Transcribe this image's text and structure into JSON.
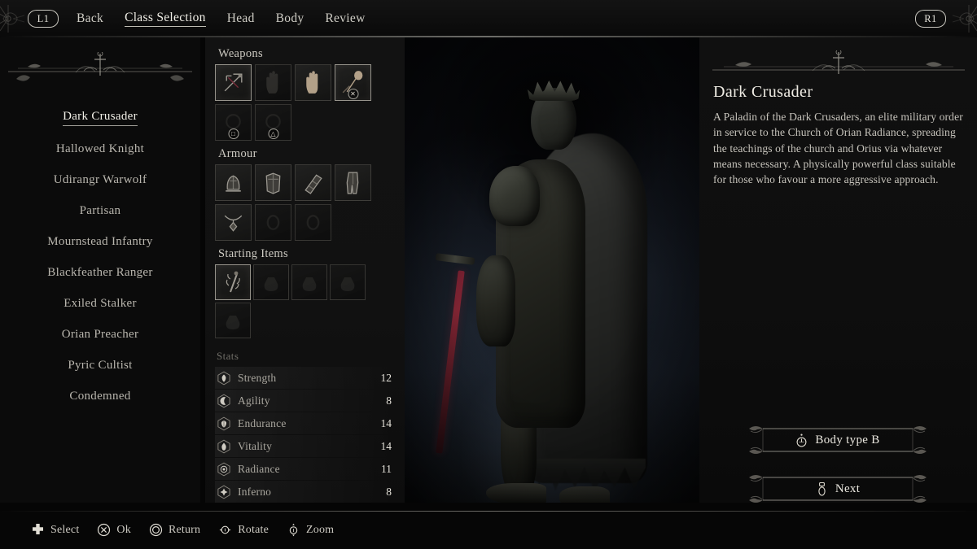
{
  "header": {
    "left_button": "L1",
    "right_button": "R1",
    "nav": [
      {
        "label": "Back",
        "active": false
      },
      {
        "label": "Class Selection",
        "active": true
      },
      {
        "label": "Head",
        "active": false
      },
      {
        "label": "Body",
        "active": false
      },
      {
        "label": "Review",
        "active": false
      }
    ]
  },
  "classes": [
    {
      "label": "Dark Crusader",
      "selected": true
    },
    {
      "label": "Hallowed Knight",
      "selected": false
    },
    {
      "label": "Udirangr Warwolf",
      "selected": false
    },
    {
      "label": "Partisan",
      "selected": false
    },
    {
      "label": "Mournstead Infantry",
      "selected": false
    },
    {
      "label": "Blackfeather Ranger",
      "selected": false
    },
    {
      "label": "Exiled Stalker",
      "selected": false
    },
    {
      "label": "Orian Preacher",
      "selected": false
    },
    {
      "label": "Pyric Cultist",
      "selected": false
    },
    {
      "label": "Condemned",
      "selected": false
    }
  ],
  "equipment": {
    "weapons_title": "Weapons",
    "weapons": [
      {
        "icon": "crossbow-icon",
        "empty": false,
        "selected": true,
        "pad": ""
      },
      {
        "icon": "left-hand-icon",
        "empty": true,
        "selected": false,
        "pad": ""
      },
      {
        "icon": "right-hand-icon",
        "empty": false,
        "selected": false,
        "pad": ""
      },
      {
        "icon": "mace-icon",
        "empty": false,
        "selected": true,
        "pad": "✕"
      },
      {
        "icon": "empty-slot-icon",
        "empty": true,
        "selected": false,
        "pad": "□"
      },
      {
        "icon": "empty-slot-icon",
        "empty": true,
        "selected": false,
        "pad": "△"
      }
    ],
    "armour_title": "Armour",
    "armour": [
      {
        "icon": "helmet-icon",
        "empty": false,
        "selected": false
      },
      {
        "icon": "chest-armour-icon",
        "empty": false,
        "selected": false
      },
      {
        "icon": "gauntlet-icon",
        "empty": false,
        "selected": false
      },
      {
        "icon": "leg-armour-icon",
        "empty": false,
        "selected": false
      },
      {
        "icon": "amulet-icon",
        "empty": false,
        "selected": false
      },
      {
        "icon": "ring-slot-icon",
        "empty": true,
        "selected": false
      },
      {
        "icon": "ring-slot-icon",
        "empty": true,
        "selected": false
      }
    ],
    "items_title": "Starting Items",
    "items": [
      {
        "icon": "sanguinarix-icon",
        "empty": false,
        "selected": true
      },
      {
        "icon": "pouch-icon",
        "empty": true,
        "selected": false
      },
      {
        "icon": "pouch-icon",
        "empty": true,
        "selected": false
      },
      {
        "icon": "pouch-icon",
        "empty": true,
        "selected": false
      },
      {
        "icon": "pouch-icon",
        "empty": true,
        "selected": false
      }
    ]
  },
  "stats": {
    "title": "Stats",
    "rows": [
      {
        "icon": "strength-icon",
        "name": "Strength",
        "value": "12"
      },
      {
        "icon": "agility-icon",
        "name": "Agility",
        "value": "8"
      },
      {
        "icon": "endurance-icon",
        "name": "Endurance",
        "value": "14"
      },
      {
        "icon": "vitality-icon",
        "name": "Vitality",
        "value": "14"
      },
      {
        "icon": "radiance-icon",
        "name": "Radiance",
        "value": "11"
      },
      {
        "icon": "inferno-icon",
        "name": "Inferno",
        "value": "8"
      }
    ]
  },
  "description": {
    "title": "Dark Crusader",
    "body": "A Paladin of the Dark Crusaders, an elite military order in service to the Church of Orian Radiance, spreading the teachings of the church and Orius via whatever means necessary. A physically powerful class suitable for those who favour a more aggressive approach."
  },
  "actions": {
    "body_type": {
      "label": "Body type B",
      "icon": "left-stick-icon"
    },
    "next": {
      "label": "Next",
      "icon": "right-stick-icon"
    }
  },
  "footer": {
    "hints": [
      {
        "icon": "dpad-icon",
        "label": "Select"
      },
      {
        "icon": "cross-button-icon",
        "label": "Ok"
      },
      {
        "icon": "circle-button-icon",
        "label": "Return"
      },
      {
        "icon": "right-stick-icon",
        "label": "Rotate"
      },
      {
        "icon": "stick-press-icon",
        "label": "Zoom"
      }
    ]
  },
  "colors": {
    "background": "#0a0a0a",
    "panel": "#111111",
    "text_primary": "#e8e5dd",
    "text_muted": "#a9a69e",
    "accent_ornament": "#bcb9b0",
    "blade_red": "#8e2736"
  }
}
